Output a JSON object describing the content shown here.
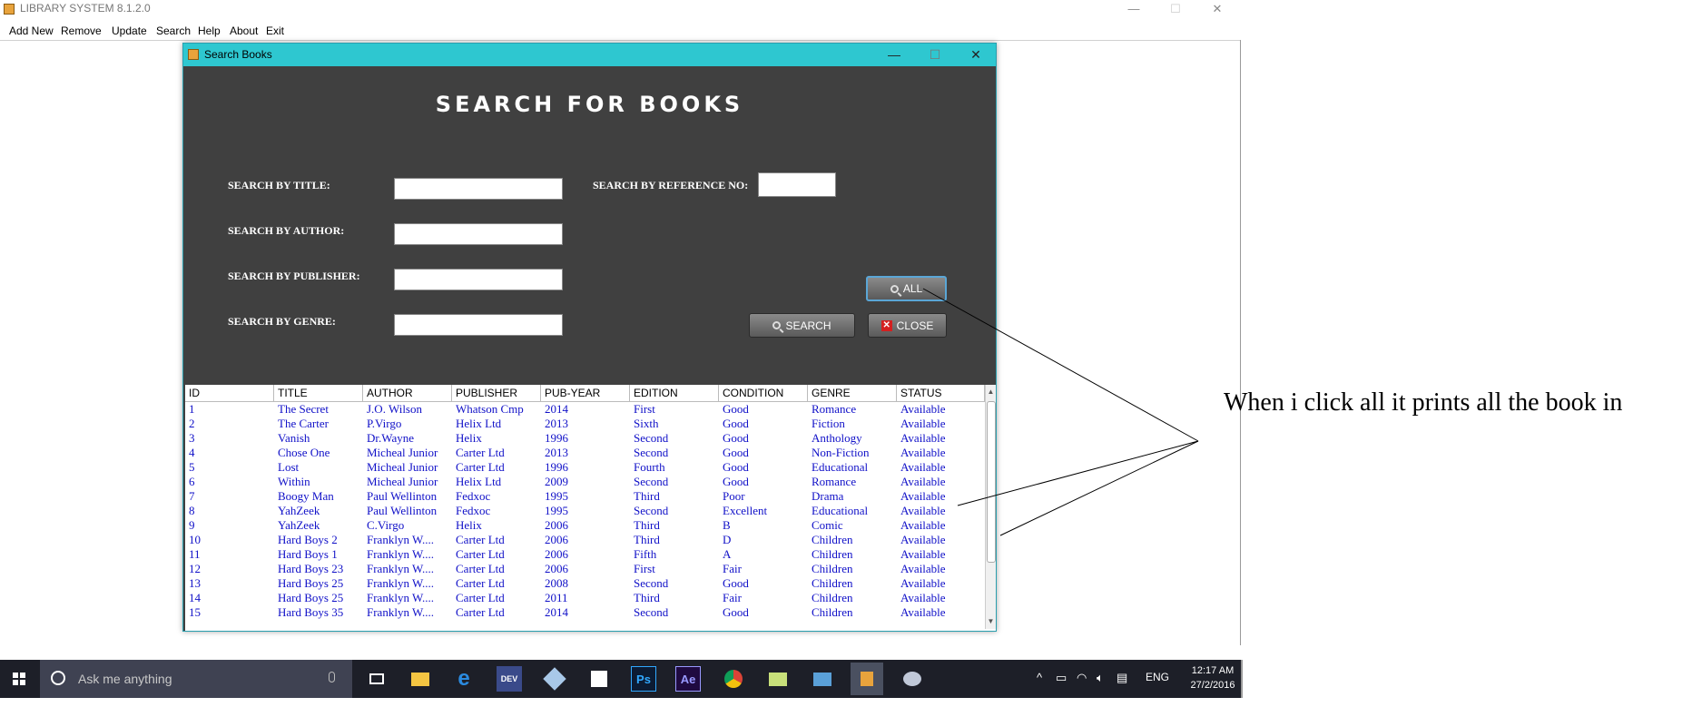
{
  "main_window": {
    "title": "LIBRARY SYSTEM 8.1.2.0",
    "controls": {
      "minimize": "—",
      "maximize": "☐",
      "close": "✕"
    },
    "menu": [
      "Add New",
      "Remove",
      "Update",
      "Search",
      "Help",
      "About",
      "Exit"
    ]
  },
  "dialog": {
    "title": "Search Books",
    "controls": {
      "minimize": "—",
      "maximize": "☐",
      "close": "✕"
    },
    "heading": "SEARCH FOR BOOKS",
    "fields": {
      "title_label": "SEARCH BY TITLE:",
      "author_label": "SEARCH BY AUTHOR:",
      "publisher_label": "SEARCH BY PUBLISHER:",
      "genre_label": "SEARCH BY GENRE:",
      "ref_label": "SEARCH BY REFERENCE NO:",
      "title_value": "",
      "author_value": "",
      "publisher_value": "",
      "genre_value": "",
      "ref_value": ""
    },
    "buttons": {
      "all": "ALL",
      "search": "SEARCH",
      "close": "CLOSE"
    },
    "icons": {
      "all": "search-icon",
      "search": "search-icon",
      "close": "close-icon"
    },
    "accent_color": "#2ec7d0"
  },
  "table": {
    "columns": [
      "ID",
      "TITLE",
      "AUTHOR",
      "PUBLISHER",
      "PUB-YEAR",
      "EDITION",
      "CONDITION",
      "GENRE",
      "STATUS"
    ],
    "rows": [
      [
        "1",
        "The Secret",
        "J.O. Wilson",
        "Whatson Cmp",
        "2014",
        "First",
        "Good",
        "Romance",
        "Available"
      ],
      [
        "2",
        "The Carter",
        "P.Virgo",
        "Helix Ltd",
        "2013",
        "Sixth",
        "Good",
        "Fiction",
        "Available"
      ],
      [
        "3",
        "Vanish",
        "Dr.Wayne",
        "Helix",
        "1996",
        "Second",
        "Good",
        "Anthology",
        "Available"
      ],
      [
        "4",
        "Chose One",
        "Micheal Junior",
        "Carter  Ltd",
        "2013",
        "Second",
        "Good",
        "Non-Fiction",
        "Available"
      ],
      [
        "5",
        "Lost",
        "Micheal Junior",
        "Carter  Ltd",
        "1996",
        "Fourth",
        "Good",
        "Educational",
        "Available"
      ],
      [
        "6",
        "Within",
        "Micheal Junior",
        "Helix Ltd",
        "2009",
        "Second",
        "Good",
        "Romance",
        "Available"
      ],
      [
        "7",
        "Boogy Man",
        "Paul Wellinton",
        "Fedxoc",
        "1995",
        "Third",
        "Poor",
        "Drama",
        "Available"
      ],
      [
        "8",
        "YahZeek",
        "Paul Wellinton",
        "Fedxoc",
        "1995",
        "Second",
        "Excellent",
        "Educational",
        "Available"
      ],
      [
        "9",
        "YahZeek",
        "C.Virgo",
        "Helix",
        "2006",
        "Third",
        "B",
        "Comic",
        "Available"
      ],
      [
        "10",
        "Hard Boys 2",
        "Franklyn W....",
        "Carter Ltd",
        "2006",
        "Third",
        "D",
        "Children",
        "Available"
      ],
      [
        "11",
        "Hard Boys 1",
        "Franklyn W....",
        "Carter Ltd",
        "2006",
        "Fifth",
        "A",
        "Children",
        "Available"
      ],
      [
        "12",
        "Hard Boys 23",
        "Franklyn W....",
        "Carter Ltd",
        "2006",
        "First",
        "Fair",
        "Children",
        "Available"
      ],
      [
        "13",
        "Hard Boys 25",
        "Franklyn W....",
        "Carter Ltd",
        "2008",
        "Second",
        "Good",
        "Children",
        "Available"
      ],
      [
        "14",
        "Hard Boys 25",
        "Franklyn W....",
        "Carter Ltd",
        "2011",
        "Third",
        "Fair",
        "Children",
        "Available"
      ],
      [
        "15",
        "Hard Boys 35",
        "Franklyn W....",
        "Carter Ltd",
        "2014",
        "Second",
        "Good",
        "Children",
        "Available"
      ]
    ],
    "text_color": "#1010c8"
  },
  "annotation": {
    "text": "When i click all it prints all the book in"
  },
  "taskbar": {
    "search_placeholder": "Ask me anything",
    "language": "ENG",
    "time": "12:17 AM",
    "date": "27/2/2016",
    "app_labels": {
      "devcpp": "DEV",
      "photoshop": "Ps",
      "aftereffects": "Ae"
    },
    "tray_up_arrow": "^",
    "background": "#1d1f28"
  }
}
